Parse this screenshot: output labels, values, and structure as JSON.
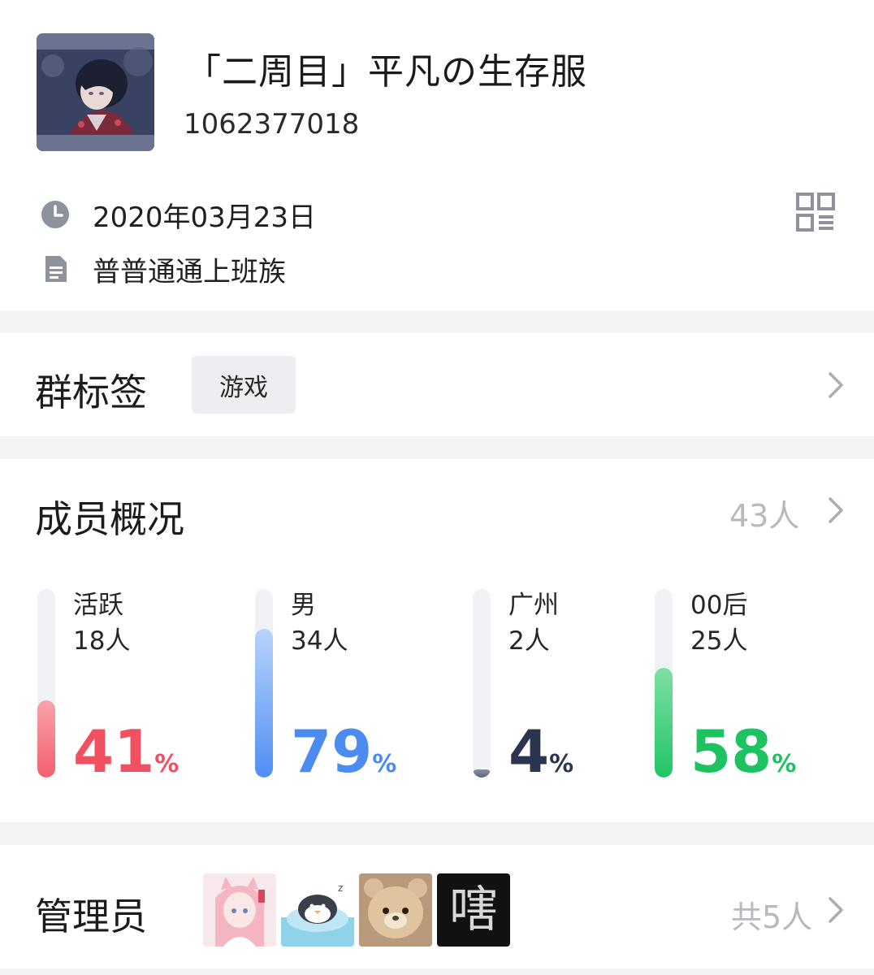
{
  "group": {
    "name": "「二周目」平凡の生存服",
    "id": "1062377018",
    "created_date": "2020年03月23日",
    "description": "普普通通上班族"
  },
  "icons": {
    "clock": "clock-icon",
    "doc": "document-icon",
    "qr": "qr-code-icon",
    "chevron": "chevron-right-icon"
  },
  "tags": {
    "title": "群标签",
    "items": [
      "游戏"
    ]
  },
  "members": {
    "title": "成员概况",
    "count": "43人",
    "stats": [
      {
        "label": "活跃",
        "count": "18人",
        "percent": "41",
        "unit": "%",
        "fraction": 0.41,
        "color_top": "#f9a3ab",
        "color_bottom": "#f2606e",
        "text_color": "#f0505f"
      },
      {
        "label": "男",
        "count": "34人",
        "percent": "79",
        "unit": "%",
        "fraction": 0.79,
        "color_top": "#b9d3fb",
        "color_bottom": "#4f8ef2",
        "text_color": "#4c8bf0"
      },
      {
        "label": "广州",
        "count": "2人",
        "percent": "4",
        "unit": "%",
        "fraction": 0.04,
        "color_top": "#8a92a8",
        "color_bottom": "#5b647c",
        "text_color": "#2c3550"
      },
      {
        "label": "00后",
        "count": "25人",
        "percent": "58",
        "unit": "%",
        "fraction": 0.58,
        "color_top": "#7ee0a4",
        "color_bottom": "#21c466",
        "text_color": "#1fc261"
      }
    ]
  },
  "admins": {
    "title": "管理员",
    "total": "共5人",
    "avatar_text_4": "嗐"
  },
  "colors": {
    "separator": "#f2f3f5",
    "muted": "#b6b9c0",
    "icon_gray": "#8e929c"
  }
}
